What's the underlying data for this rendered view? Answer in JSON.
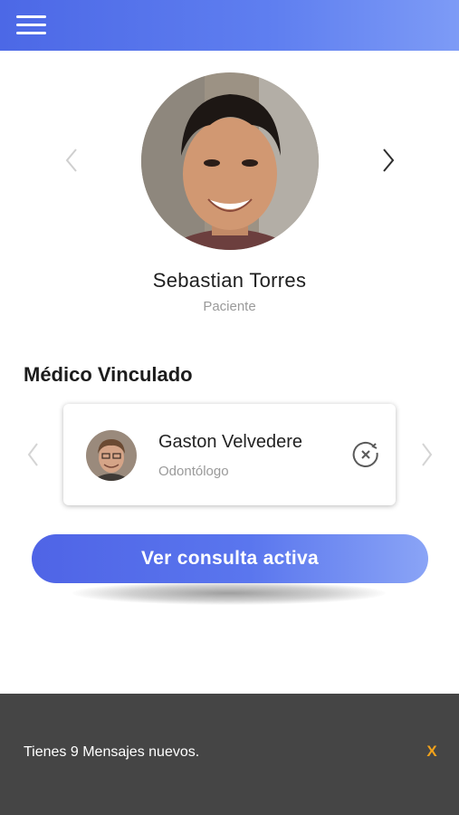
{
  "header": {
    "menu_icon": "hamburger-icon",
    "background_color": "#5873ec"
  },
  "patient": {
    "name": "Sebastian Torres",
    "role": "Paciente"
  },
  "linked_doctor": {
    "section_title": "Médico Vinculado",
    "name": "Gaston Velvedere",
    "specialty": "Odontólogo",
    "unlink_icon": "unlink-circle-icon"
  },
  "primary_action": {
    "label": "Ver consulta activa"
  },
  "snackbar": {
    "message": "Tienes 9 Mensajes nuevos.",
    "close_label": "X",
    "close_color": "#f2a21b"
  },
  "colors": {
    "accent": "#5169e8",
    "snackbar_bg": "#454545"
  }
}
